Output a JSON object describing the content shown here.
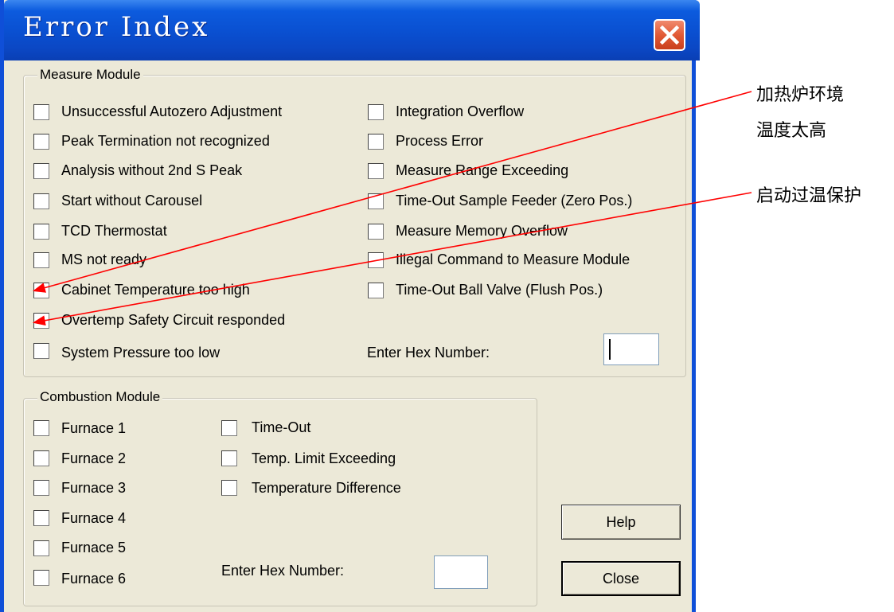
{
  "window": {
    "title": "Error Index",
    "close_glyph": "✕"
  },
  "measure_module": {
    "label": "Measure Module",
    "left_items": [
      {
        "label": "Unsuccessful Autozero Adjustment"
      },
      {
        "label": "Peak Termination not recognized"
      },
      {
        "label": "Analysis without 2nd S Peak"
      },
      {
        "label": "Start without Carousel"
      },
      {
        "label": "TCD Thermostat"
      },
      {
        "label": "MS not ready"
      },
      {
        "label": "Cabinet Temperature too high"
      },
      {
        "label": "Overtemp Safety Circuit responded"
      },
      {
        "label": "System Pressure too low"
      }
    ],
    "right_items": [
      {
        "label": "Integration Overflow"
      },
      {
        "label": "Process Error"
      },
      {
        "label": "Measure Range Exceeding"
      },
      {
        "label": "Time-Out Sample Feeder (Zero Pos.)"
      },
      {
        "label": "Measure Memory Overflow"
      },
      {
        "label": "Illegal Command to Measure Module"
      },
      {
        "label": "Time-Out Ball Valve (Flush Pos.)"
      }
    ],
    "hex_label": "Enter Hex Number:",
    "hex_value": ""
  },
  "combustion_module": {
    "label": "Combustion Module",
    "left_items": [
      {
        "label": "Furnace 1"
      },
      {
        "label": "Furnace 2"
      },
      {
        "label": "Furnace 3"
      },
      {
        "label": "Furnace 4"
      },
      {
        "label": "Furnace 5"
      },
      {
        "label": "Furnace 6"
      }
    ],
    "right_items": [
      {
        "label": "Time-Out"
      },
      {
        "label": "Temp. Limit Exceeding"
      },
      {
        "label": "Temperature Difference"
      }
    ],
    "hex_label": "Enter Hex Number:",
    "hex_value": ""
  },
  "buttons": {
    "help": "Help",
    "close": "Close"
  },
  "annotations": {
    "cabinet_line1": "加热炉环境",
    "cabinet_line2": "温度太高",
    "overtemp": "启动过温保护",
    "arrow_color": "#ff0000"
  },
  "colors": {
    "titlebar": "#0a4fd0",
    "dialog_bg": "#ece9d8",
    "close_button": "#e25a36"
  }
}
